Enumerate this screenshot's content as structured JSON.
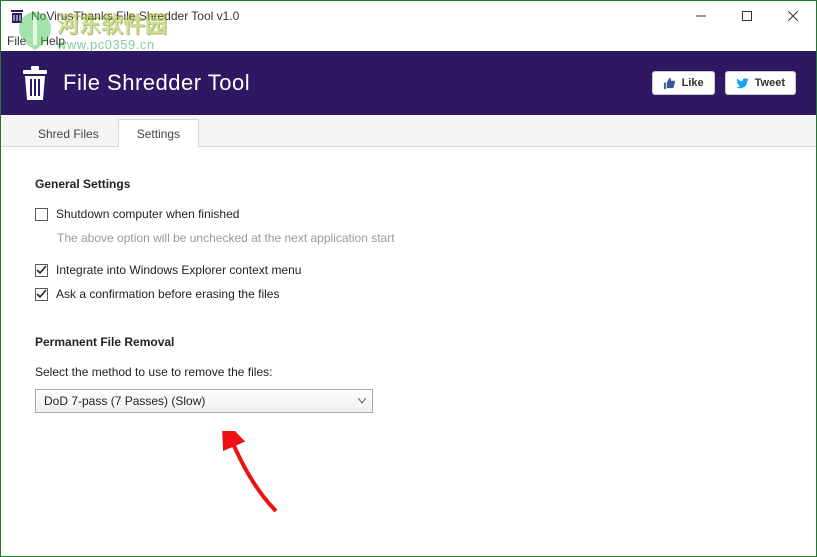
{
  "window": {
    "title": "NoVirusThanks File Shredder Tool v1.0"
  },
  "menu": {
    "file": "File",
    "help": "Help"
  },
  "hero": {
    "title": "File Shredder Tool",
    "like_label": "Like",
    "tweet_label": "Tweet"
  },
  "tabs": {
    "shred": "Shred Files",
    "settings": "Settings"
  },
  "settings": {
    "general_heading": "General Settings",
    "shutdown_label": "Shutdown computer when finished",
    "shutdown_checked": false,
    "shutdown_hint": "The above option will be unchecked at the next application start",
    "integrate_label": "Integrate into Windows Explorer context menu",
    "integrate_checked": true,
    "confirm_label": "Ask a confirmation before erasing the files",
    "confirm_checked": true,
    "removal_heading": "Permanent File Removal",
    "method_prompt": "Select the method to use to remove the files:",
    "method_selected": "DoD 7-pass (7 Passes) (Slow)"
  },
  "watermark": {
    "line1": "河东软件园",
    "line2": "www.pc0359.cn"
  }
}
